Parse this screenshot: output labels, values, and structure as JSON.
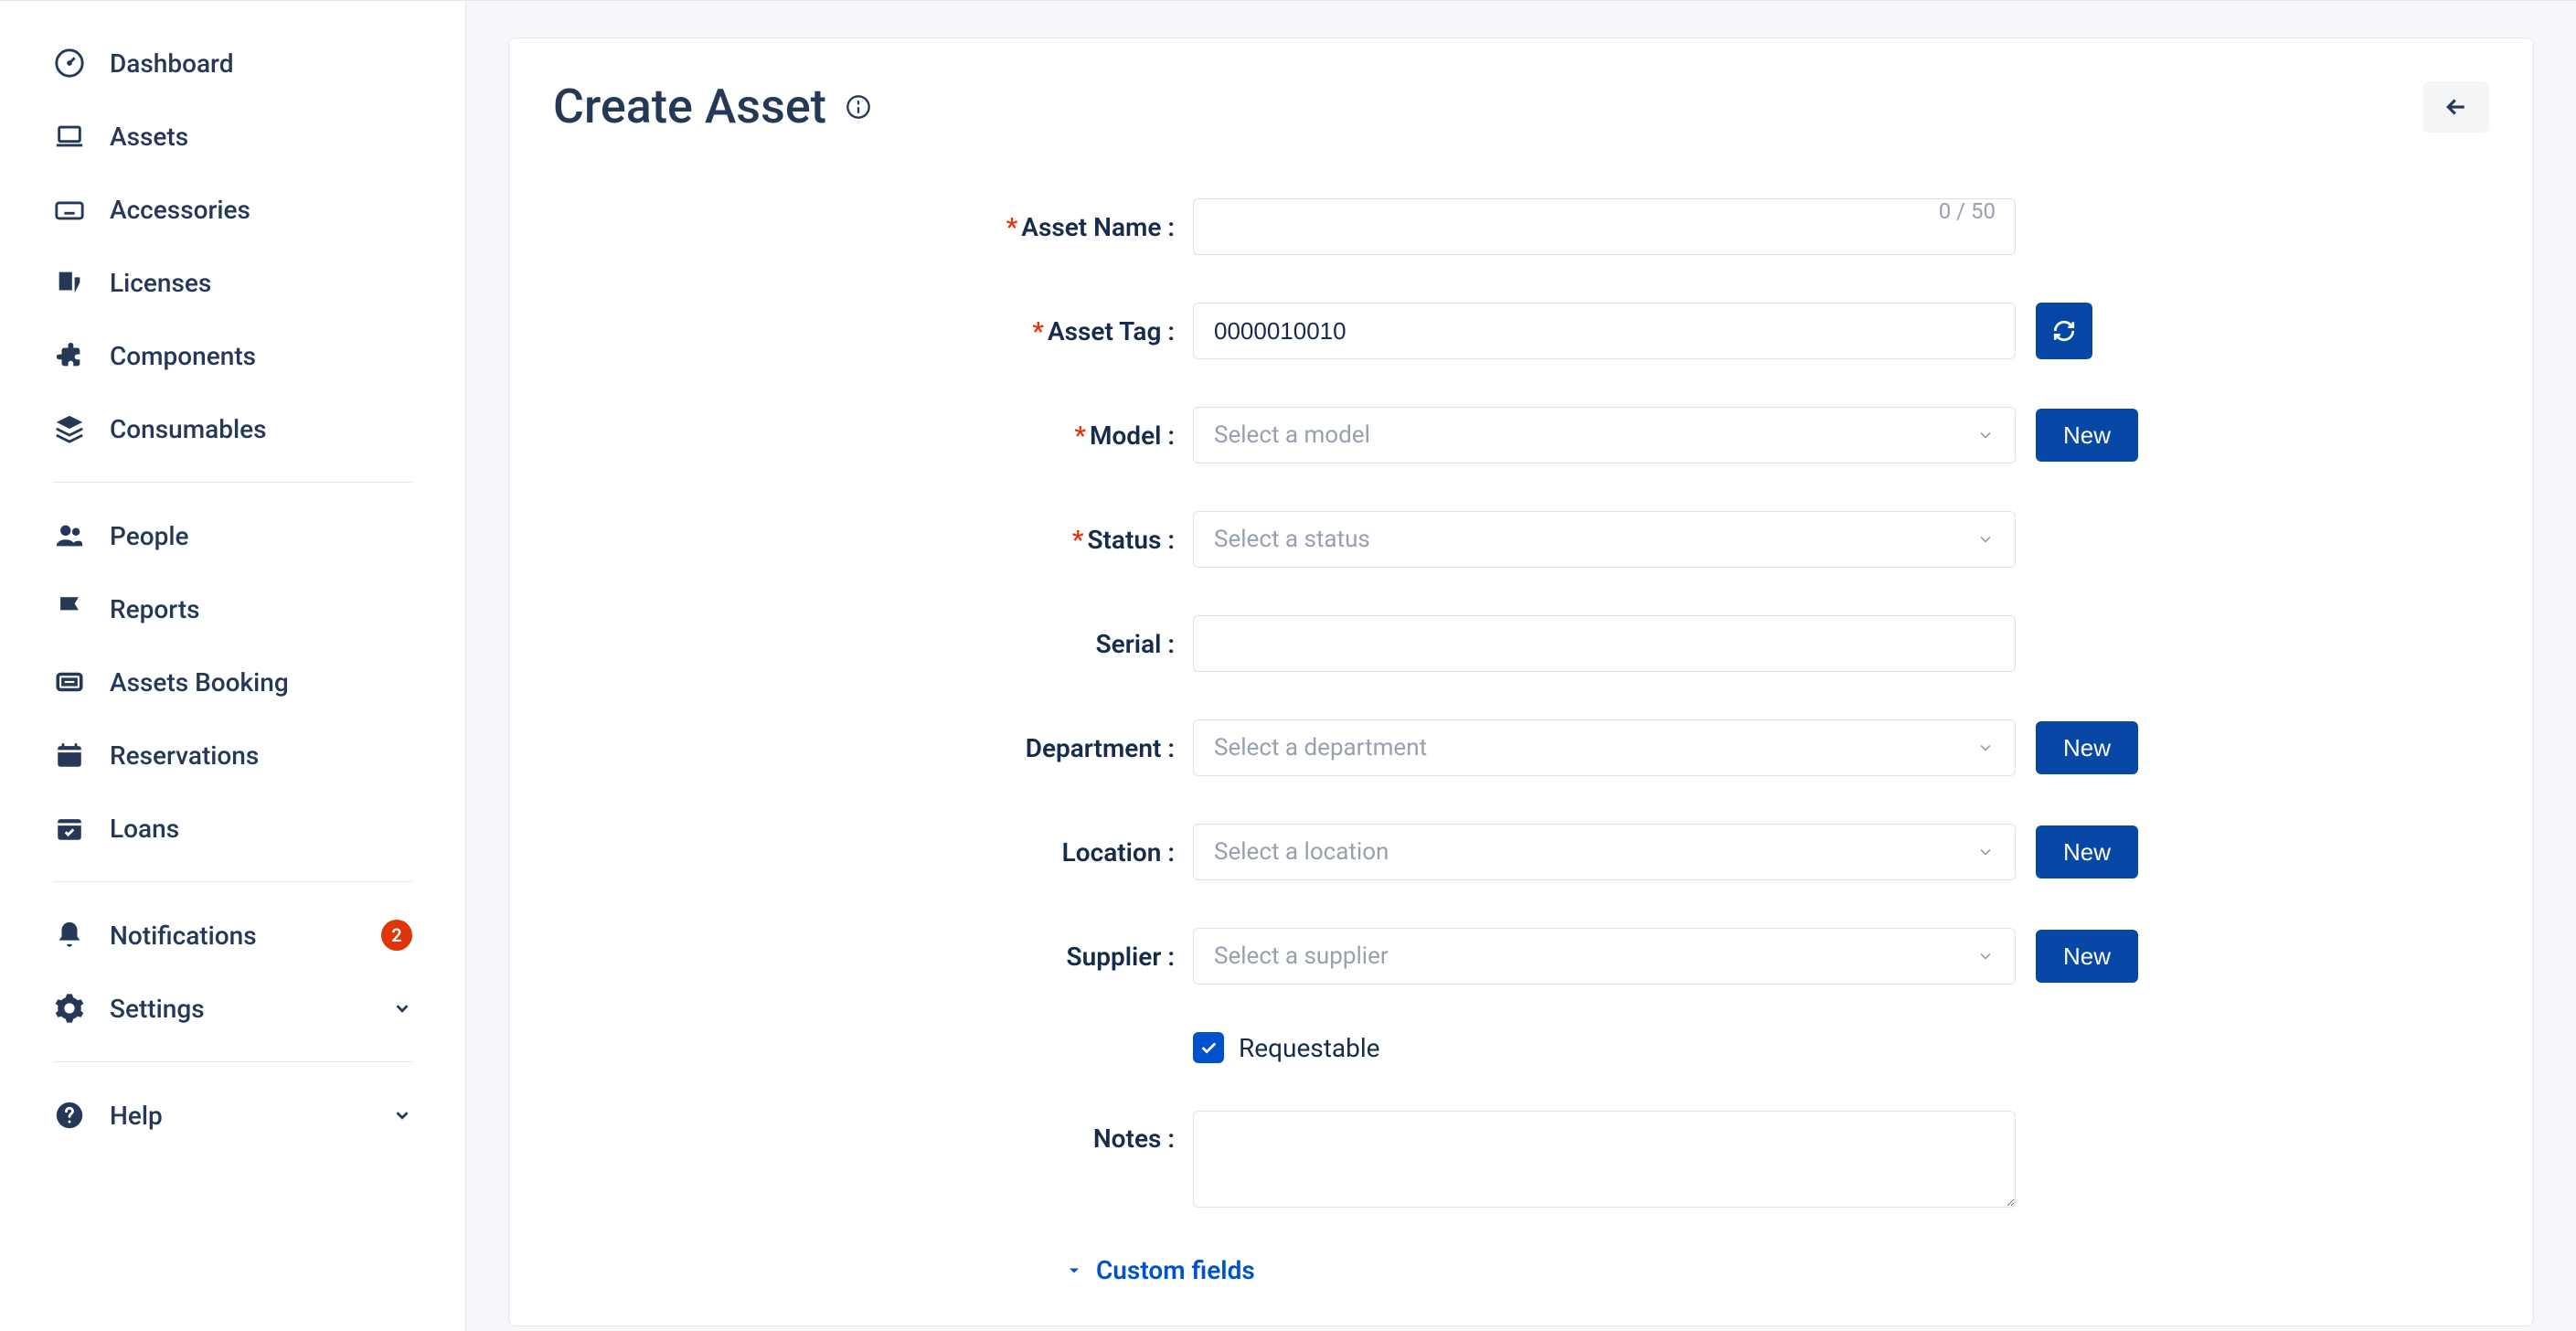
{
  "sidebar": {
    "groups": [
      [
        {
          "icon": "gauge",
          "label": "Dashboard"
        },
        {
          "icon": "laptop",
          "label": "Assets"
        },
        {
          "icon": "keyboard",
          "label": "Accessories"
        },
        {
          "icon": "license",
          "label": "Licenses"
        },
        {
          "icon": "puzzle",
          "label": "Components"
        },
        {
          "icon": "layers",
          "label": "Consumables"
        }
      ],
      [
        {
          "icon": "people",
          "label": "People"
        },
        {
          "icon": "flag",
          "label": "Reports"
        },
        {
          "icon": "ticket",
          "label": "Assets Booking"
        },
        {
          "icon": "calendar",
          "label": "Reservations"
        },
        {
          "icon": "calcheck",
          "label": "Loans"
        }
      ],
      [
        {
          "icon": "bell",
          "label": "Notifications",
          "badge": "2"
        },
        {
          "icon": "gear",
          "label": "Settings",
          "chevron": true
        }
      ],
      [
        {
          "icon": "help",
          "label": "Help",
          "chevron": true
        }
      ]
    ]
  },
  "page": {
    "title": "Create Asset"
  },
  "form": {
    "asset_name": {
      "label": "Asset Name",
      "required": true,
      "value": "",
      "counter": "0 / 50"
    },
    "asset_tag": {
      "label": "Asset Tag",
      "required": true,
      "value": "0000010010"
    },
    "model": {
      "label": "Model",
      "required": true,
      "placeholder": "Select a model",
      "new": "New"
    },
    "status": {
      "label": "Status",
      "required": true,
      "placeholder": "Select a status"
    },
    "serial": {
      "label": "Serial",
      "value": ""
    },
    "department": {
      "label": "Department",
      "placeholder": "Select a department",
      "new": "New"
    },
    "location": {
      "label": "Location",
      "placeholder": "Select a location",
      "new": "New"
    },
    "supplier": {
      "label": "Supplier",
      "placeholder": "Select a supplier",
      "new": "New"
    },
    "requestable": {
      "label": "Requestable",
      "checked": true
    },
    "notes": {
      "label": "Notes",
      "value": ""
    },
    "custom_fields": {
      "label": "Custom fields"
    }
  }
}
